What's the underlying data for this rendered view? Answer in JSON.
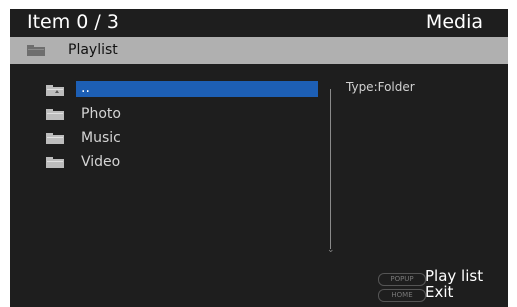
{
  "header": {
    "item_count": "Item 0 / 3",
    "mode": "Media"
  },
  "path": {
    "label": "Playlist",
    "icon": "folder-icon"
  },
  "list": {
    "items": [
      {
        "label": "..",
        "icon": "parent-folder-icon",
        "selected": true
      },
      {
        "label": "Photo",
        "icon": "folder-icon"
      },
      {
        "label": "Music",
        "icon": "folder-icon"
      },
      {
        "label": "Video",
        "icon": "folder-icon"
      }
    ]
  },
  "info": {
    "type_text": "Type:Folder"
  },
  "footer": {
    "popup": {
      "key": "POPUP",
      "label": "Play list"
    },
    "home": {
      "key": "HOME",
      "label": "Exit"
    }
  },
  "colors": {
    "background": "#1e1e1e",
    "selection": "#1d5fb5",
    "path_bar": "#b0b0b0"
  }
}
